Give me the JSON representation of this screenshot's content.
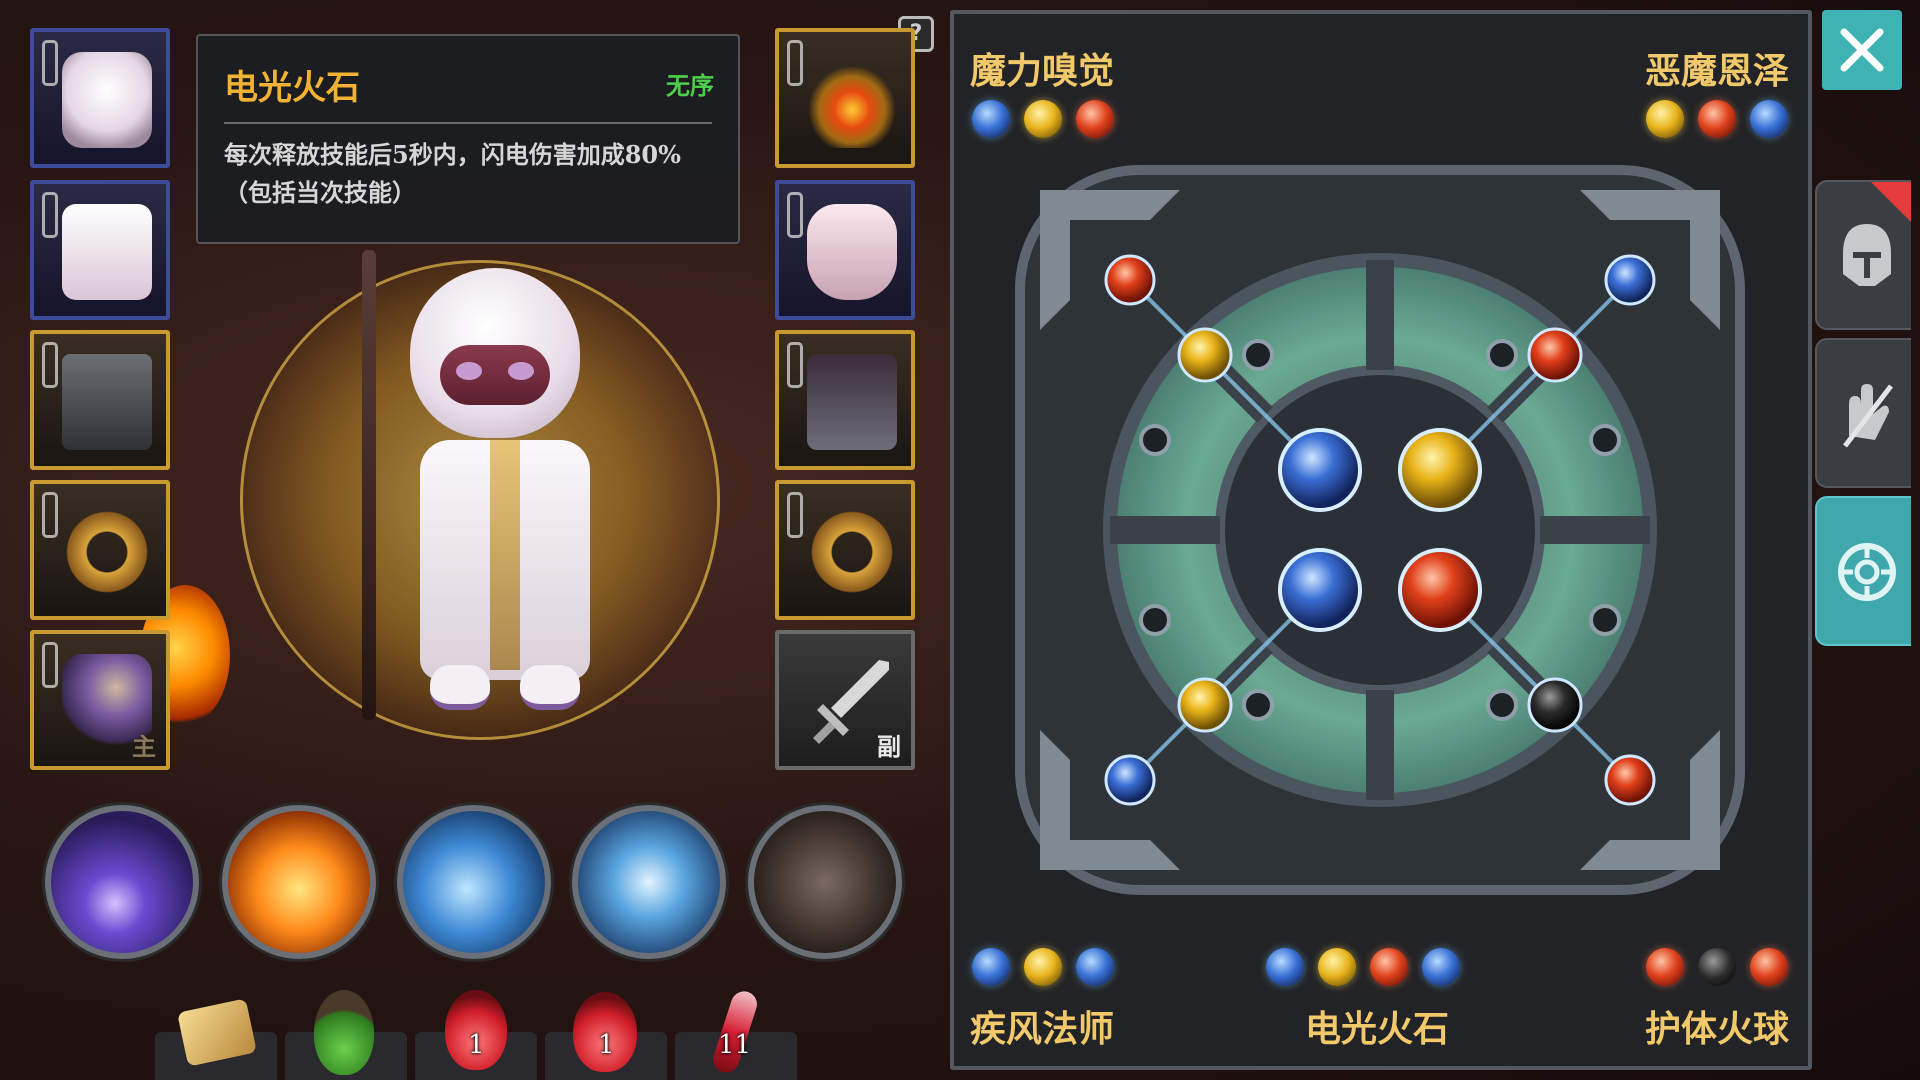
{
  "help_icon": "?",
  "tooltip": {
    "name": "电光火石",
    "order": "无序",
    "description": "每次释放技能后5秒内，闪电伤害加成80%（包括当次技能）"
  },
  "equipment": {
    "left_slots": [
      {
        "name": "hood-icon",
        "quality": "blue"
      },
      {
        "name": "robe-icon",
        "quality": "blue"
      },
      {
        "name": "armor-icon",
        "quality": "gold"
      },
      {
        "name": "ring-icon",
        "quality": "gold"
      },
      {
        "name": "mace-icon",
        "quality": "gold",
        "tag": "主"
      }
    ],
    "right_slots": [
      {
        "name": "amulet-icon",
        "quality": "gold"
      },
      {
        "name": "glove-icon",
        "quality": "blue"
      },
      {
        "name": "boots-icon",
        "quality": "gold"
      },
      {
        "name": "ring-icon",
        "quality": "gold"
      },
      {
        "name": "sword-icon",
        "quality": "empty",
        "tag": "副"
      }
    ]
  },
  "skills": [
    {
      "name": "lightning-orb-skill-icon"
    },
    {
      "name": "fire-skill-icon"
    },
    {
      "name": "ice-shard-skill-icon"
    },
    {
      "name": "lightning-storm-skill-icon"
    },
    {
      "name": "dash-skill-icon"
    }
  ],
  "consumables": [
    {
      "name": "map-scroll-icon",
      "count": ""
    },
    {
      "name": "green-potion-icon",
      "count": ""
    },
    {
      "name": "red-potion-icon",
      "count": "1"
    },
    {
      "name": "red-flask-icon",
      "count": "1"
    },
    {
      "name": "red-vial-icon",
      "count": "11"
    }
  ],
  "rune_combos": [
    {
      "title": "魔力嗅觉",
      "gems": [
        "blue",
        "yellow",
        "red"
      ]
    },
    {
      "title": "恶魔恩泽",
      "gems": [
        "yellow",
        "red",
        "blue"
      ]
    },
    {
      "title": "疾风法师",
      "gems": [
        "blue",
        "yellow",
        "blue"
      ]
    },
    {
      "title": "电光火石",
      "gems": [
        "blue",
        "yellow",
        "red",
        "blue"
      ]
    },
    {
      "title": "护体火球",
      "gems": [
        "red",
        "black",
        "red"
      ]
    }
  ],
  "rune_board": {
    "outer_gems": [
      "red",
      "blue",
      "blue",
      "red"
    ],
    "inner_ring_gems": [
      "yellow",
      "red",
      "yellow",
      "black"
    ],
    "center_gems": [
      "blue",
      "yellow",
      "blue",
      "red"
    ]
  },
  "sidebar": {
    "close_icon": "close-icon",
    "tabs": [
      {
        "name": "helmet-icon",
        "active": false,
        "notification": true
      },
      {
        "name": "glove-sword-icon",
        "active": false,
        "notification": false
      },
      {
        "name": "rune-icon",
        "active": true,
        "notification": false
      }
    ]
  },
  "colors": {
    "accent_teal": "#3fb3b3",
    "title_gold": "#f1c86a",
    "tooltip_name": "#f2b233",
    "order_green": "#4cd04c"
  }
}
